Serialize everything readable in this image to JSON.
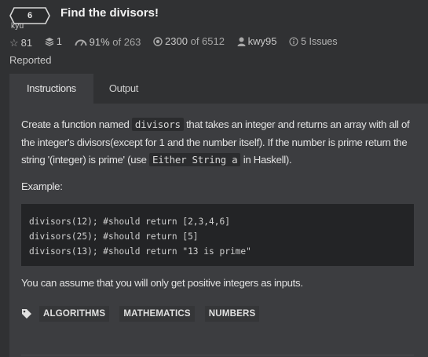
{
  "header": {
    "rank": "6",
    "rank_word": "kyu",
    "title": "Find the divisors!"
  },
  "stats": {
    "stars": "81",
    "collections": "1",
    "satisfaction": "91%",
    "satisfaction_of": "of 263",
    "completed": "2300",
    "completed_of": "of 6512",
    "author": "kwy95",
    "issues": "5 Issues",
    "issues_reported": "Reported"
  },
  "tabs": [
    {
      "label": "Instructions",
      "active": true
    },
    {
      "label": "Output",
      "active": false
    }
  ],
  "description": {
    "part1": "Create a function named ",
    "code1": "divisors",
    "part2": " that takes an integer and returns an array with all of the integer's divisors(except for 1 and the number itself). If the number is prime return the string '(integer) is prime' (use ",
    "code2": "Either String a",
    "part3": " in Haskell).",
    "example_label": "Example:",
    "code_lines": [
      "divisors(12); #should return [2,3,4,6]",
      "divisors(25); #should return [5]",
      "divisors(13); #should return \"13 is prime\""
    ],
    "assume": "You can assume that you will only get positive integers as inputs."
  },
  "tags": [
    "ALGORITHMS",
    "MATHEMATICS",
    "NUMBERS"
  ],
  "icons": {
    "rank": "hexagon-badge",
    "stars": "star-icon",
    "collections": "collection-icon",
    "satisfaction": "gauge-icon",
    "completed": "target-icon",
    "author": "user-icon",
    "issues": "info-icon",
    "tags": "tag-icon"
  }
}
